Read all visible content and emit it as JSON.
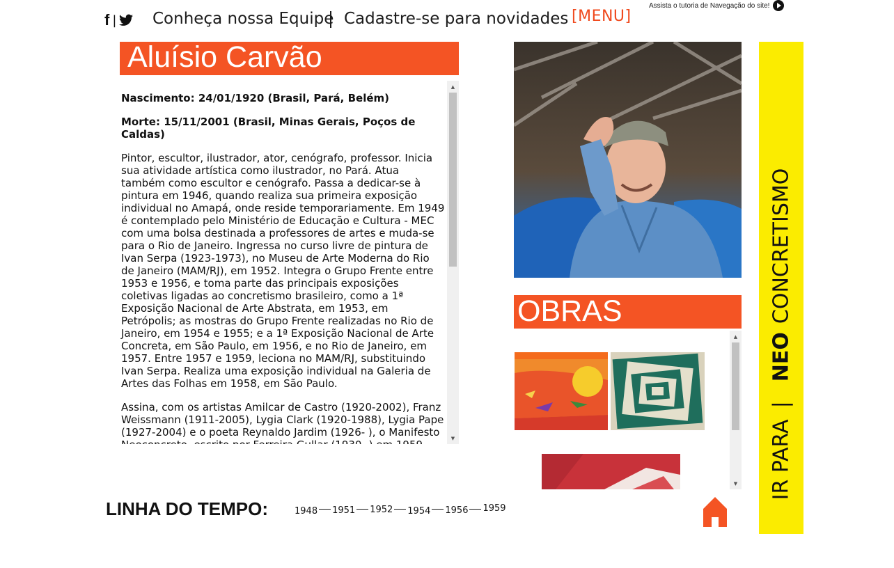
{
  "header": {
    "social": {
      "facebook": "f",
      "separator": "|",
      "twitter_icon": "twitter-bird-icon"
    },
    "nav": [
      {
        "label": "Conheça nossa Equipe"
      },
      {
        "label": "Cadastre-se para novidades"
      }
    ],
    "menu_label": "[MENU]",
    "tutorial_text": "Assista o tutoria de Navegação do site!"
  },
  "artist": {
    "name": "Aluísio Carvão",
    "birth": "Nascimento: 24/01/1920 (Brasil, Pará, Belém)",
    "death": "Morte: 15/11/2001 (Brasil, Minas Gerais, Poços de Caldas)",
    "bio": [
      "Pintor, escultor, ilustrador, ator, cenógrafo, professor. Inicia sua atividade artística como ilustrador, no Pará. Atua também como escultor e cenógrafo. Passa a dedicar-se à pintura em 1946, quando realiza sua primeira exposição individual no Amapá, onde reside temporariamente. Em 1949 é contemplado pelo Ministério de Educação e Cultura - MEC com uma bolsa destinada a professores de artes e muda-se para o Rio de Janeiro. Ingressa no curso livre de pintura de Ivan Serpa (1923-1973), no Museu de Arte Moderna do Rio de Janeiro (MAM/RJ), em 1952. Integra o Grupo Frente entre 1953 e 1956, e toma parte das principais exposições coletivas ligadas ao concretismo brasileiro, como a 1ª Exposição Nacional de Arte Abstrata, em 1953, em Petrópolis; as mostras do Grupo Frente realizadas no Rio de Janeiro, em 1954 e 1955; e a 1ª Exposição Nacional de Arte Concreta, em São Paulo, em 1956, e no Rio de Janeiro, em 1957. Entre 1957 e 1959, leciona no MAM/RJ, substituindo Ivan Serpa. Realiza uma exposição individual na Galeria de Artes das Folhas em 1958, em São Paulo.",
      "Assina, com os artistas Amilcar de Castro (1920-2002), Franz Weissmann (1911-2005), Lygia Clark (1920-1988), Lygia Pape (1927-2004) e o poeta Reynaldo Jardim (1926- ), o Manifesto Neoconcreto, escrito por Ferreira Gullar (1930- ) em 1959. Com esse grupo de artistas, participa da Exposição de Arte Neoconcreta, em 1959, no Rio de Janeiro, também exibida em"
    ]
  },
  "obras": {
    "title": "OBRAS"
  },
  "side": {
    "prefix": "IR PARA",
    "separator": "|",
    "neo": "NEO",
    "rest": "CONCRETISMO"
  },
  "timeline": {
    "label": "LINHA DO TEMPO:",
    "years": [
      "1948",
      "1951",
      "1952",
      "1954",
      "1956",
      "1959"
    ]
  },
  "colors": {
    "accent": "#f45424",
    "side_panel": "#fbec00",
    "menu": "#f04a1e"
  }
}
